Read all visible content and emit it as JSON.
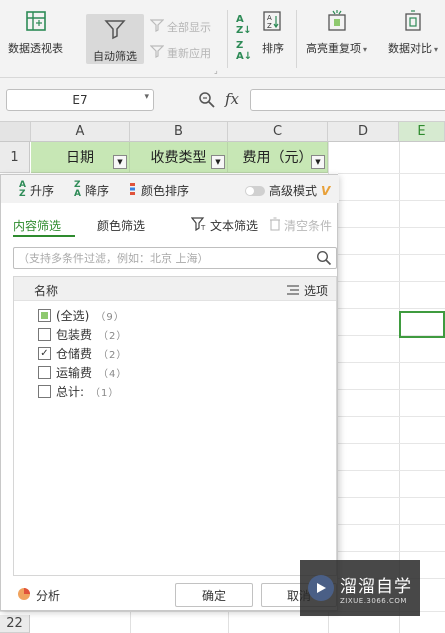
{
  "ribbon": {
    "pivot_label": "数据透视表",
    "autofilter_label": "自动筛选",
    "show_all_label": "全部显示",
    "reapply_label": "重新应用",
    "sort_label": "排序",
    "highlight_dup_label": "高亮重复项",
    "compare_label": "数据对比"
  },
  "formula_bar": {
    "cell_ref": "E7",
    "fx_label": "fx"
  },
  "sheet": {
    "columns": [
      "A",
      "B",
      "C",
      "D",
      "E"
    ],
    "rows": [
      "1",
      "22"
    ],
    "headers": [
      "日期",
      "收费类型",
      "费用（元）"
    ]
  },
  "filter_panel": {
    "asc_label": "升序",
    "desc_label": "降序",
    "color_sort_label": "颜色排序",
    "advanced_label": "高级模式",
    "tab_content": "内容筛选",
    "tab_color": "颜色筛选",
    "text_filter_label": "文本筛选",
    "clear_label": "清空条件",
    "search_placeholder": "（支持多条件过滤，例如：北京 上海）",
    "list_header": "名称",
    "options_label": "选项",
    "items": [
      {
        "label": "(全选)",
        "count": "（9）",
        "state": "partial"
      },
      {
        "label": "包装费",
        "count": "（2）",
        "state": "unchecked"
      },
      {
        "label": "仓储费",
        "count": "（2）",
        "state": "checked"
      },
      {
        "label": "运输费",
        "count": "（4）",
        "state": "unchecked"
      },
      {
        "label": "总计:",
        "count": "（1）",
        "state": "unchecked"
      }
    ],
    "analyze_label": "分析",
    "ok_label": "确定",
    "cancel_label": "取消"
  },
  "watermark": {
    "title": "溜溜自学",
    "url": "ZIXUE.3066.COM"
  }
}
